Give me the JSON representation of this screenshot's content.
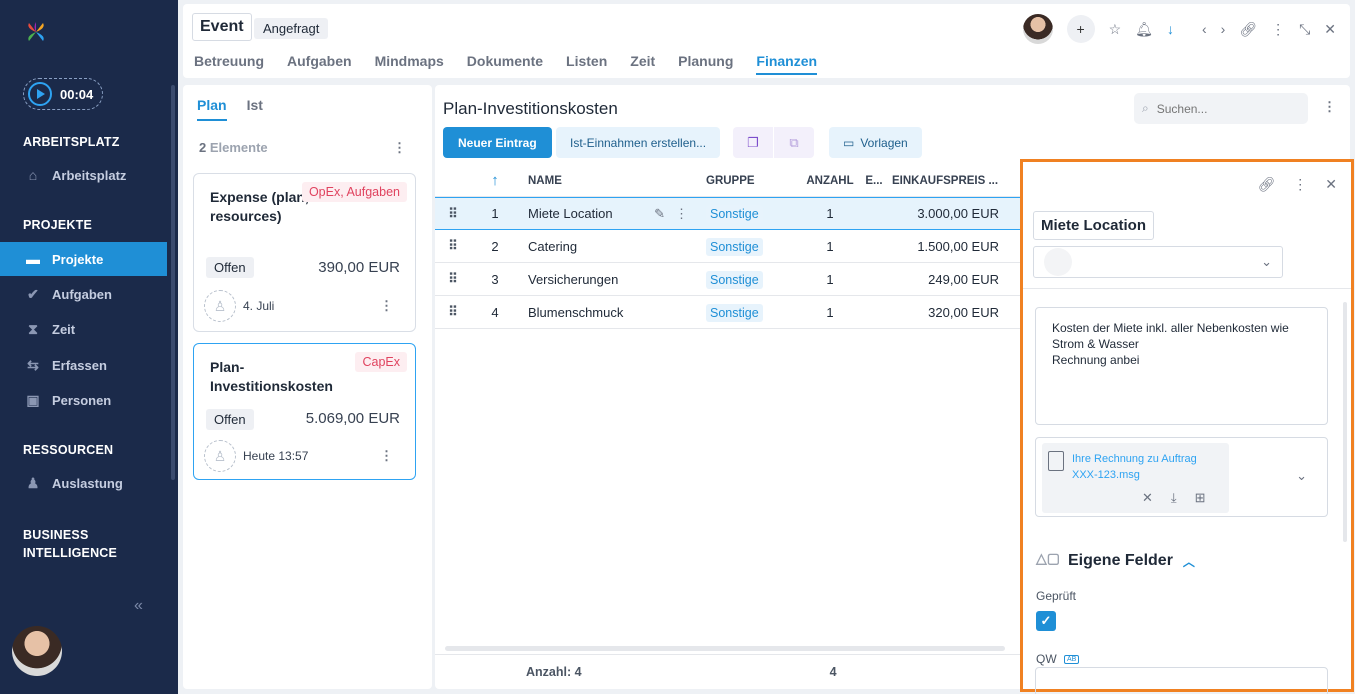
{
  "sidebar": {
    "timer": "00:04",
    "sections": [
      {
        "title": "ARBEITSPLATZ"
      },
      {
        "title": "PROJEKTE"
      },
      {
        "title": "RESSOURCEN"
      },
      {
        "title": "BUSINESS INTELLIGENCE"
      }
    ],
    "items": [
      {
        "label": "Arbeitsplatz",
        "icon": "home-icon"
      },
      {
        "label": "Projekte",
        "icon": "folder-icon"
      },
      {
        "label": "Aufgaben",
        "icon": "check-circle-icon"
      },
      {
        "label": "Zeit",
        "icon": "hourglass-icon"
      },
      {
        "label": "Erfassen",
        "icon": "transfer-icon"
      },
      {
        "label": "Personen",
        "icon": "contact-icon"
      },
      {
        "label": "Auslastung",
        "icon": "person-icon"
      }
    ],
    "accent": "#1f8fd6",
    "background": "#1b2a4a"
  },
  "header": {
    "title": "Event",
    "status": "Angefragt",
    "tabs": [
      "Betreuung",
      "Aufgaben",
      "Mindmaps",
      "Dokumente",
      "Listen",
      "Zeit",
      "Planung",
      "Finanzen"
    ],
    "active_tab": "Finanzen"
  },
  "left": {
    "tabs": [
      "Plan",
      "Ist"
    ],
    "count_num": "2",
    "count_label": "Elemente",
    "cards": [
      {
        "title": "Expense (plan, resources)",
        "tag": "OpEx, Aufgaben",
        "status": "Offen",
        "amount": "390,00 EUR",
        "date": "4. Juli"
      },
      {
        "title": "Plan-Investitionskosten",
        "tag": "CapEx",
        "status": "Offen",
        "amount": "5.069,00 EUR",
        "date": "Heute 13:57"
      }
    ]
  },
  "main": {
    "title": "Plan-Investitionskosten",
    "search_placeholder": "Suchen...",
    "btn_new": "Neuer Eintrag",
    "btn_ist": "Ist-Einnahmen erstellen...",
    "btn_templates": "Vorlagen",
    "columns": {
      "name": "NAME",
      "group": "GRUPPE",
      "qty": "ANZAHL",
      "e": "E...",
      "price": "EINKAUFSPREIS ..."
    },
    "rows": [
      {
        "num": "1",
        "name": "Miete Location",
        "group": "Sonstige",
        "qty": "1",
        "price": "3.000,00 EUR"
      },
      {
        "num": "2",
        "name": "Catering",
        "group": "Sonstige",
        "qty": "1",
        "price": "1.500,00 EUR"
      },
      {
        "num": "3",
        "name": "Versicherungen",
        "group": "Sonstige",
        "qty": "1",
        "price": "249,00 EUR"
      },
      {
        "num": "4",
        "name": "Blumenschmuck",
        "group": "Sonstige",
        "qty": "1",
        "price": "320,00 EUR"
      }
    ],
    "footer_count": "Anzahl: 4",
    "footer_qty": "4"
  },
  "detail": {
    "title": "Miete Location",
    "description": "Kosten der Miete inkl. aller Nebenkosten wie Strom & Wasser\nRechnung anbei",
    "file_name": "Ihre Rechnung zu Auftrag XXX-123.msg",
    "section_title": "Eigene Felder",
    "field_checked_label": "Geprüft",
    "field_qw_label": "QW",
    "highlight_color": "#f08122"
  }
}
